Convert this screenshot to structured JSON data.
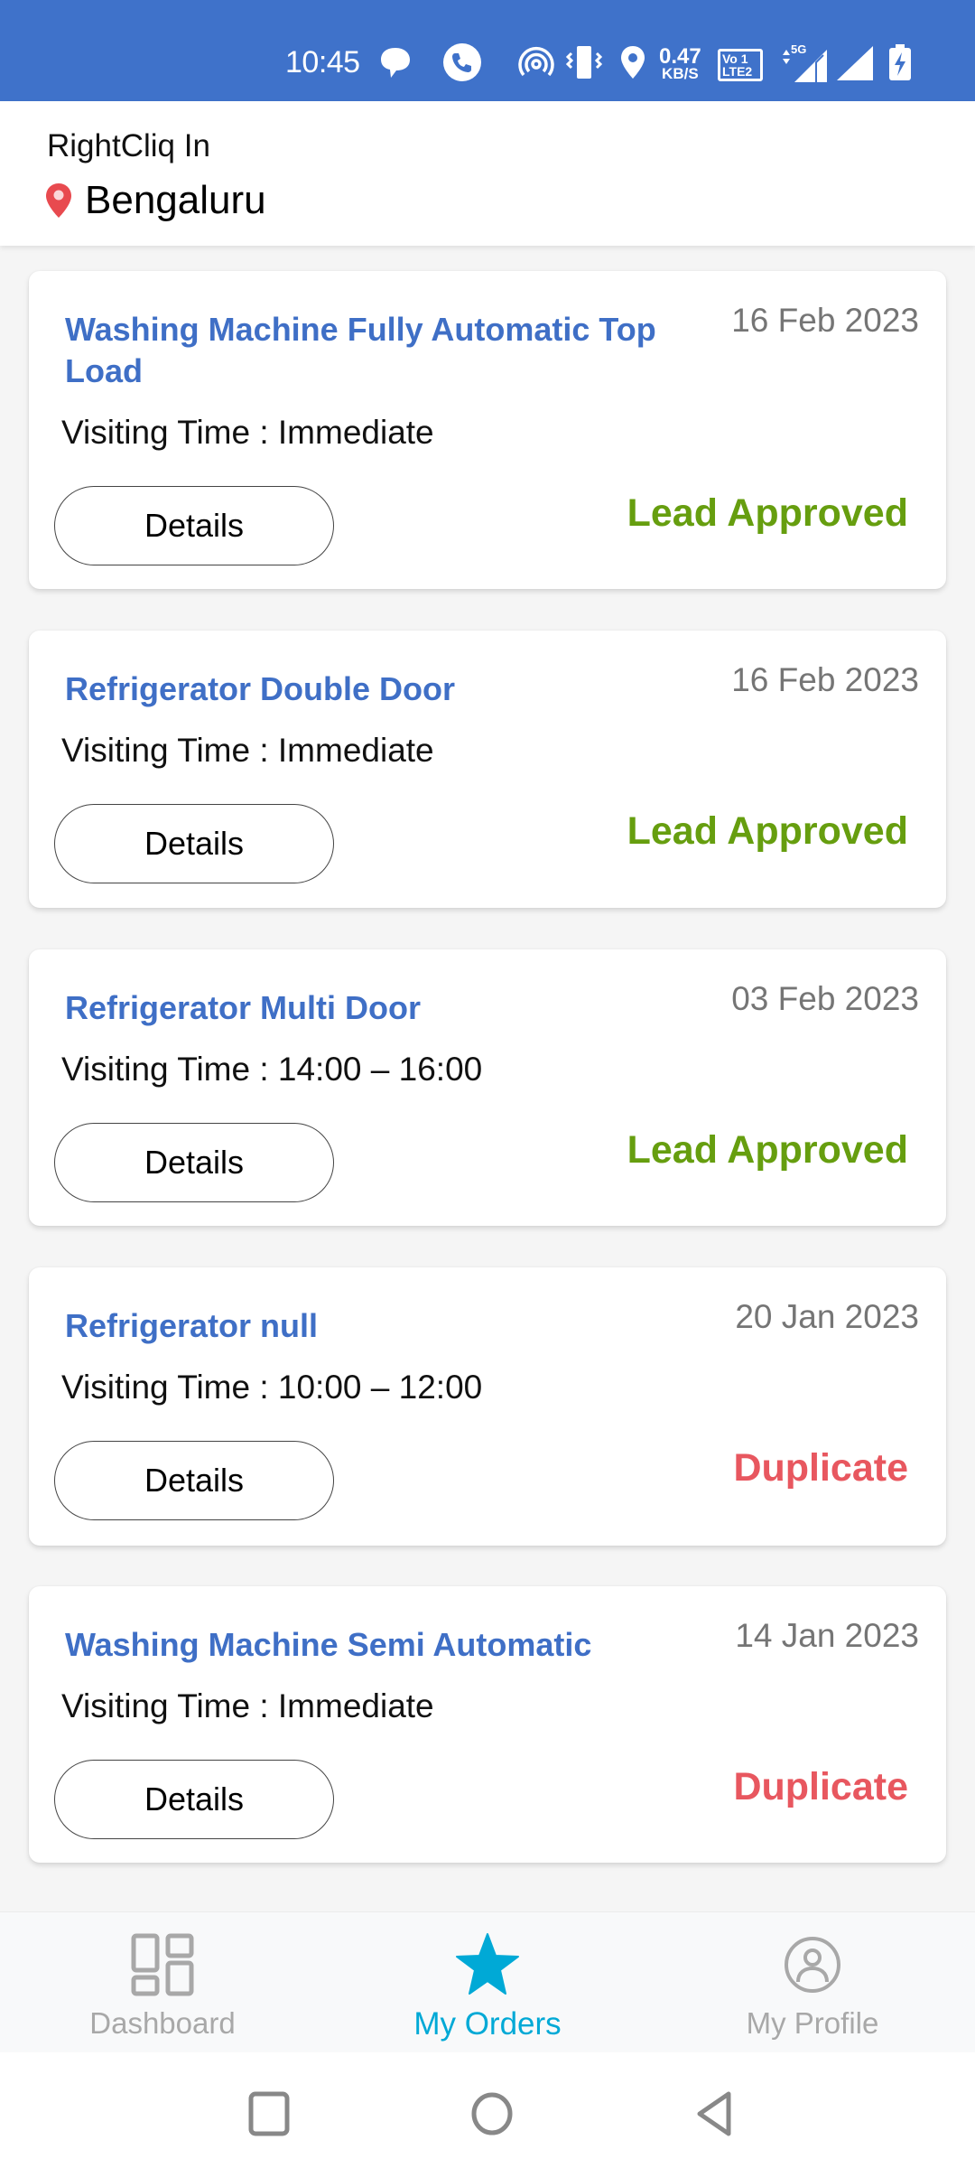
{
  "status_bar": {
    "time": "10:45",
    "net_speed_value": "0.47",
    "net_speed_unit": "KB/S",
    "volte_top": "Vo",
    "volte_sim1": "1",
    "volte_bottom": "LTE",
    "volte_sim2": "2",
    "network_type": "5G",
    "icons": [
      "chat-bubble-icon",
      "phone-call-icon",
      "hotspot-icon",
      "vibrate-icon",
      "location-icon",
      "volte-icon",
      "signal-5g-icon",
      "signal-icon",
      "battery-charging-icon"
    ]
  },
  "header": {
    "app_name": "RightCliq In",
    "location": "Bengaluru",
    "location_icon": "map-pin-icon"
  },
  "colors": {
    "status_bar": "#3F72CA",
    "title_blue": "#3F6FC6",
    "approved_green": "#669E0F",
    "duplicate_red": "#E8575F",
    "active_nav": "#00A9D6",
    "inactive_nav": "#A8A8A8"
  },
  "orders": [
    {
      "title": "Washing Machine Fully Automatic Top Load",
      "date": "16 Feb 2023",
      "visiting_time": "Visiting Time : Immediate",
      "button": "Details",
      "status": "Lead Approved",
      "status_type": "approved"
    },
    {
      "title": "Refrigerator Double Door",
      "date": "16 Feb 2023",
      "visiting_time": "Visiting Time : Immediate",
      "button": "Details",
      "status": "Lead Approved",
      "status_type": "approved"
    },
    {
      "title": "Refrigerator Multi Door",
      "date": "03 Feb 2023",
      "visiting_time": "Visiting Time : 14:00 – 16:00",
      "button": "Details",
      "status": "Lead Approved",
      "status_type": "approved"
    },
    {
      "title": "Refrigerator null",
      "date": "20 Jan 2023",
      "visiting_time": "Visiting Time : 10:00 – 12:00",
      "button": "Details",
      "status": "Duplicate",
      "status_type": "duplicate"
    },
    {
      "title": "Washing Machine Semi Automatic",
      "date": "14 Jan 2023",
      "visiting_time": "Visiting Time : Immediate",
      "button": "Details",
      "status": "Duplicate",
      "status_type": "duplicate"
    }
  ],
  "bottom_nav": {
    "items": [
      {
        "label": "Dashboard",
        "icon": "dashboard-icon",
        "active": false
      },
      {
        "label": "My Orders",
        "icon": "star-icon",
        "active": true
      },
      {
        "label": "My Profile",
        "icon": "profile-icon",
        "active": false
      }
    ]
  },
  "system_nav": {
    "buttons": [
      "recents-button",
      "home-button",
      "back-button"
    ]
  }
}
